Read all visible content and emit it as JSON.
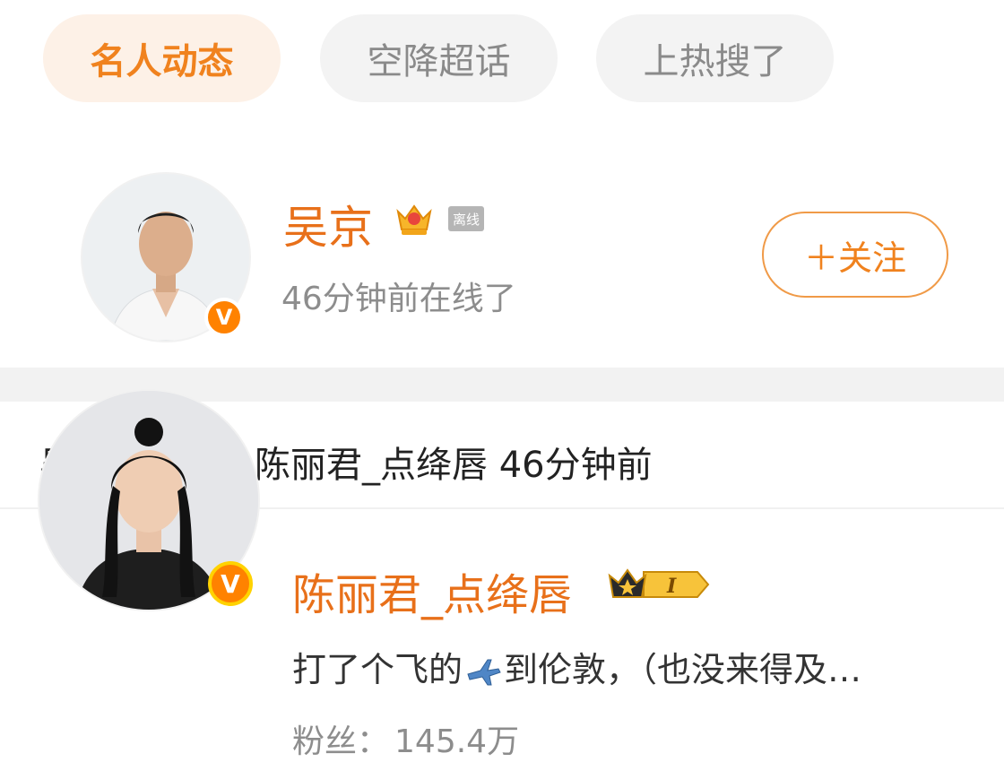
{
  "tabs": [
    {
      "label": "名人动态",
      "active": true
    },
    {
      "label": "空降超话",
      "active": false
    },
    {
      "label": "上热搜了",
      "active": false
    }
  ],
  "user1": {
    "name": "吴京",
    "status_badge": "离线",
    "online_text": "46分钟前在线了",
    "follow_label": "＋关注",
    "badge_icon": "crown-vip-icon",
    "verified_icon": "verified-v-icon"
  },
  "activity": {
    "text": "吴京关注了@陈丽君_点绛唇 46分钟前"
  },
  "user2": {
    "name": "陈丽君_点绛唇",
    "level_badge": "I",
    "bio_before": "打了个飞的",
    "bio_emoji": "airplane-emoji-icon",
    "bio_after": "到伦敦，（也没来得及…",
    "fans_label": "粉丝：",
    "fans_value": "145.4万",
    "verified_icon": "verified-v-icon"
  },
  "colors": {
    "accent": "#f0821e",
    "name": "#e8701a",
    "muted": "#8d8d8d",
    "divider": "#f2f2f2"
  }
}
